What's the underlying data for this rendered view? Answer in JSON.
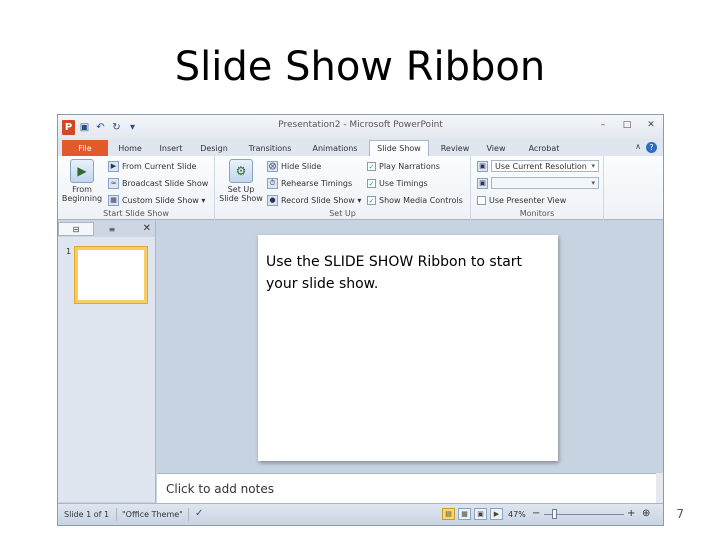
{
  "page": {
    "title": "Slide Show Ribbon",
    "slide_number": "7"
  },
  "window": {
    "title": "Presentation2 - Microsoft PowerPoint",
    "controls": {
      "minimize": "–",
      "maximize": "□",
      "close": "✕"
    },
    "help": "?",
    "minimize_ribbon": "∧"
  },
  "qat": {
    "logo": "P",
    "save": "▣",
    "undo": "↶",
    "redo": "↻",
    "customize": "▾"
  },
  "tabs": {
    "file": "File",
    "home": "Home",
    "insert": "Insert",
    "design": "Design",
    "transitions": "Transitions",
    "animations": "Animations",
    "slideshow": "Slide Show",
    "review": "Review",
    "view": "View",
    "acrobat": "Acrobat"
  },
  "ribbon": {
    "start": {
      "label": "Start Slide Show",
      "from_beginning": "From Beginning",
      "from_current": "From Current Slide",
      "broadcast": "Broadcast Slide Show",
      "custom": "Custom Slide Show ▾"
    },
    "setup": {
      "label": "Set Up",
      "setup_show": "Set Up Slide Show",
      "hide_slide": "Hide Slide",
      "rehearse": "Rehearse Timings",
      "record": "Record Slide Show ▾",
      "play_narrations": "Play Narrations",
      "use_timings": "Use Timings",
      "show_media": "Show Media Controls"
    },
    "monitors": {
      "label": "Monitors",
      "resolution": "Use Current Resolution",
      "show_on": "",
      "presenter_view": "Use Presenter View"
    }
  },
  "pane": {
    "tab_slides": "⊟",
    "tab_outline": "≡",
    "close": "✕",
    "thumb_number": "1"
  },
  "slide": {
    "text": "Use the SLIDE SHOW Ribbon to start your slide show."
  },
  "notes": {
    "placeholder": "Click to add notes"
  },
  "status": {
    "slide_count": "Slide 1 of 1",
    "theme": "\"Office Theme\"",
    "zoom": "47%",
    "zoom_out": "−",
    "zoom_in": "+",
    "fit": "⊕"
  }
}
